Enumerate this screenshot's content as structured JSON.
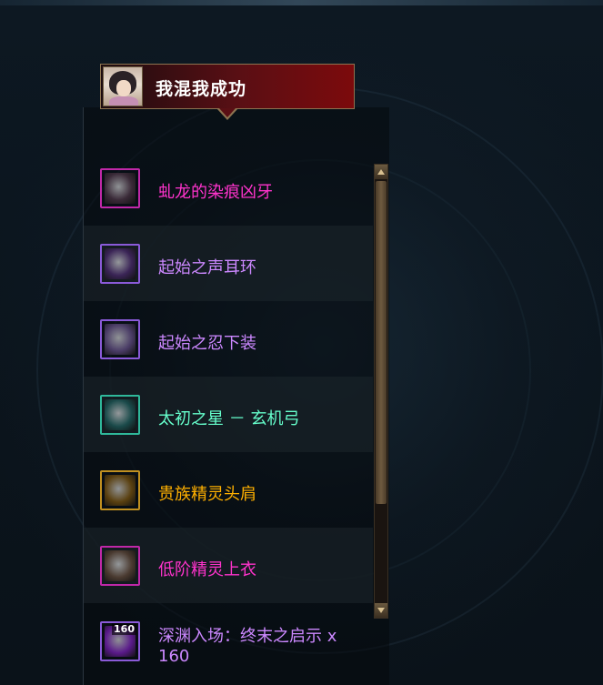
{
  "header": {
    "player_name": "我混我成功",
    "avatar": "character-portrait"
  },
  "colors": {
    "rare": "#ff33cc",
    "epic": "#cc88ff",
    "set_epic": "#66ffcc",
    "legendary": "#ffb000"
  },
  "items": [
    {
      "name": "虬龙的染痕凶牙",
      "color": "#ff33cc",
      "icon": "dragon-fang-icon",
      "frame": "#c028a8",
      "fill": "#3a2a38",
      "count": ""
    },
    {
      "name": "起始之声耳环",
      "color": "#cc88ff",
      "icon": "earring-icon",
      "frame": "#8a5ad8",
      "fill": "#3a2456",
      "count": ""
    },
    {
      "name": "起始之忍下装",
      "color": "#cc88ff",
      "icon": "pants-icon",
      "frame": "#8a5ad8",
      "fill": "#4a3c66",
      "count": ""
    },
    {
      "name": "太初之星 － 玄机弓",
      "color": "#66ffcc",
      "icon": "bow-icon",
      "frame": "#2fb89a",
      "fill": "#1a4a4a",
      "count": ""
    },
    {
      "name": "贵族精灵头肩",
      "color": "#ffb000",
      "icon": "shoulder-icon",
      "frame": "#c09020",
      "fill": "#5a4010",
      "count": ""
    },
    {
      "name": "低阶精灵上衣",
      "color": "#ff33cc",
      "icon": "tunic-icon",
      "frame": "#c028a8",
      "fill": "#4a3a30",
      "count": ""
    },
    {
      "name": "深渊入场：终末之启示 x 160",
      "color": "#cc88ff",
      "icon": "abyss-orb-icon",
      "frame": "#8a5ad8",
      "fill": "#5a1a8a",
      "count": "160"
    }
  ]
}
